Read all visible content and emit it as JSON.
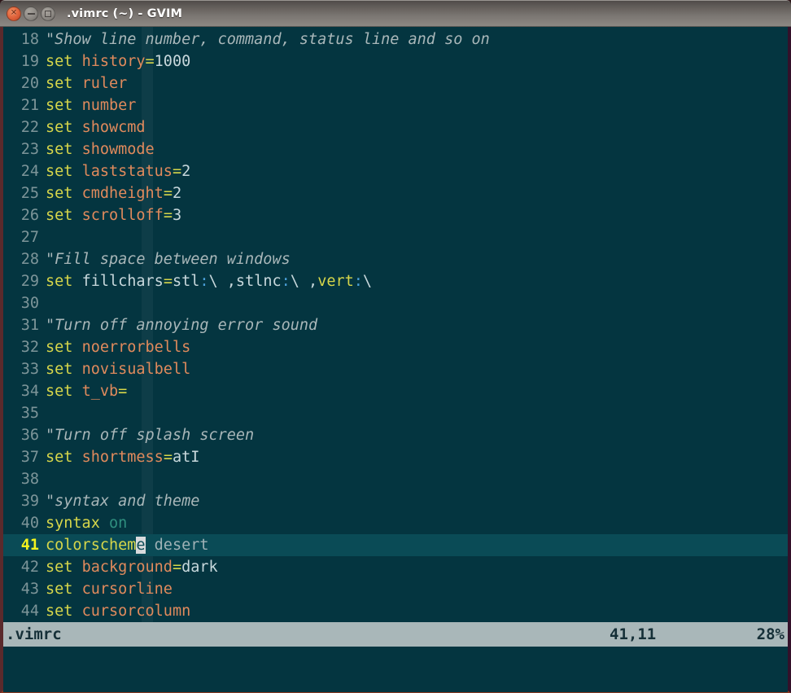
{
  "window": {
    "title": ".vimrc (~) - GVIM",
    "buttons": [
      {
        "name": "close",
        "glyph": "✕"
      },
      {
        "name": "minimize",
        "glyph": "–"
      },
      {
        "name": "maximize",
        "glyph": "□"
      }
    ]
  },
  "editor": {
    "first_visible_line": 18,
    "cursor_line": 41,
    "cursor_col": 11,
    "lines": [
      {
        "num": "18",
        "tokens": [
          {
            "t": "\"Show line number, command, status line and so on",
            "c": "cm"
          }
        ]
      },
      {
        "num": "19",
        "tokens": [
          {
            "t": "set",
            "c": "kw"
          },
          {
            "t": " ",
            "c": "pln"
          },
          {
            "t": "history",
            "c": "opt"
          },
          {
            "t": "=",
            "c": "eq"
          },
          {
            "t": "1000",
            "c": "num"
          }
        ]
      },
      {
        "num": "20",
        "tokens": [
          {
            "t": "set",
            "c": "kw"
          },
          {
            "t": " ",
            "c": "pln"
          },
          {
            "t": "ruler",
            "c": "opt"
          }
        ]
      },
      {
        "num": "21",
        "tokens": [
          {
            "t": "set",
            "c": "kw"
          },
          {
            "t": " ",
            "c": "pln"
          },
          {
            "t": "number",
            "c": "opt"
          }
        ]
      },
      {
        "num": "22",
        "tokens": [
          {
            "t": "set",
            "c": "kw"
          },
          {
            "t": " ",
            "c": "pln"
          },
          {
            "t": "showcmd",
            "c": "opt"
          }
        ]
      },
      {
        "num": "23",
        "tokens": [
          {
            "t": "set",
            "c": "kw"
          },
          {
            "t": " ",
            "c": "pln"
          },
          {
            "t": "showmode",
            "c": "opt"
          }
        ]
      },
      {
        "num": "24",
        "tokens": [
          {
            "t": "set",
            "c": "kw"
          },
          {
            "t": " ",
            "c": "pln"
          },
          {
            "t": "laststatus",
            "c": "opt"
          },
          {
            "t": "=",
            "c": "eq"
          },
          {
            "t": "2",
            "c": "num"
          }
        ]
      },
      {
        "num": "25",
        "tokens": [
          {
            "t": "set",
            "c": "kw"
          },
          {
            "t": " ",
            "c": "pln"
          },
          {
            "t": "cmdheight",
            "c": "opt"
          },
          {
            "t": "=",
            "c": "eq"
          },
          {
            "t": "2",
            "c": "num"
          }
        ]
      },
      {
        "num": "26",
        "tokens": [
          {
            "t": "set",
            "c": "kw"
          },
          {
            "t": " ",
            "c": "pln"
          },
          {
            "t": "scrolloff",
            "c": "opt"
          },
          {
            "t": "=",
            "c": "eq"
          },
          {
            "t": "3",
            "c": "num"
          }
        ]
      },
      {
        "num": "27",
        "tokens": []
      },
      {
        "num": "28",
        "tokens": [
          {
            "t": "\"Fill space between windows",
            "c": "cm"
          }
        ]
      },
      {
        "num": "29",
        "tokens": [
          {
            "t": "set",
            "c": "kw"
          },
          {
            "t": " ",
            "c": "pln"
          },
          {
            "t": "fillchars",
            "c": "pln"
          },
          {
            "t": "=",
            "c": "eq"
          },
          {
            "t": "stl",
            "c": "pln"
          },
          {
            "t": ":",
            "c": "col"
          },
          {
            "t": "\\ ,stlnc",
            "c": "pln"
          },
          {
            "t": ":",
            "c": "col"
          },
          {
            "t": "\\ ,",
            "c": "pln"
          },
          {
            "t": "vert",
            "c": "kw"
          },
          {
            "t": ":",
            "c": "col"
          },
          {
            "t": "\\",
            "c": "pln"
          }
        ]
      },
      {
        "num": "30",
        "tokens": []
      },
      {
        "num": "31",
        "tokens": [
          {
            "t": "\"Turn off annoying error sound",
            "c": "cm"
          }
        ]
      },
      {
        "num": "32",
        "tokens": [
          {
            "t": "set",
            "c": "kw"
          },
          {
            "t": " ",
            "c": "pln"
          },
          {
            "t": "noerrorbells",
            "c": "opt"
          }
        ]
      },
      {
        "num": "33",
        "tokens": [
          {
            "t": "set",
            "c": "kw"
          },
          {
            "t": " ",
            "c": "pln"
          },
          {
            "t": "novisualbell",
            "c": "opt"
          }
        ]
      },
      {
        "num": "34",
        "tokens": [
          {
            "t": "set",
            "c": "kw"
          },
          {
            "t": " ",
            "c": "pln"
          },
          {
            "t": "t_vb",
            "c": "opt"
          },
          {
            "t": "=",
            "c": "eq"
          }
        ]
      },
      {
        "num": "35",
        "tokens": []
      },
      {
        "num": "36",
        "tokens": [
          {
            "t": "\"Turn off splash screen",
            "c": "cm"
          }
        ]
      },
      {
        "num": "37",
        "tokens": [
          {
            "t": "set",
            "c": "kw"
          },
          {
            "t": " ",
            "c": "pln"
          },
          {
            "t": "shortmess",
            "c": "opt"
          },
          {
            "t": "=",
            "c": "eq"
          },
          {
            "t": "atI",
            "c": "num"
          }
        ]
      },
      {
        "num": "38",
        "tokens": []
      },
      {
        "num": "39",
        "tokens": [
          {
            "t": "\"syntax and theme",
            "c": "cm"
          }
        ]
      },
      {
        "num": "40",
        "tokens": [
          {
            "t": "syntax",
            "c": "kw"
          },
          {
            "t": " ",
            "c": "pln"
          },
          {
            "t": "on",
            "c": "on"
          }
        ]
      },
      {
        "num": "41",
        "cursorline": true,
        "tokens": [
          {
            "t": "colorschem",
            "c": "schm"
          },
          {
            "t": "e",
            "c": "schm",
            "cursor": true
          },
          {
            "t": " ",
            "c": "pln"
          },
          {
            "t": "desert",
            "c": "dsrt"
          }
        ]
      },
      {
        "num": "42",
        "tokens": [
          {
            "t": "set",
            "c": "kw"
          },
          {
            "t": " ",
            "c": "pln"
          },
          {
            "t": "background",
            "c": "opt"
          },
          {
            "t": "=",
            "c": "eq"
          },
          {
            "t": "dark",
            "c": "num"
          }
        ]
      },
      {
        "num": "43",
        "tokens": [
          {
            "t": "set",
            "c": "kw"
          },
          {
            "t": " ",
            "c": "pln"
          },
          {
            "t": "cursorline",
            "c": "opt"
          }
        ]
      },
      {
        "num": "44",
        "tokens": [
          {
            "t": "set",
            "c": "kw"
          },
          {
            "t": " ",
            "c": "pln"
          },
          {
            "t": "cursorcolumn",
            "c": "opt"
          }
        ]
      }
    ]
  },
  "statusline": {
    "filename": ".vimrc",
    "ruler": "41,11",
    "percent": "28%"
  },
  "cmdline": {
    "text": ""
  },
  "colors": {
    "editor_bg": "#043540",
    "cursorline_bg": "#0a4b56",
    "statusline_bg": "#a9b7b9",
    "statusline_fg": "#163038",
    "linenumber_fg": "#7d9599",
    "comment": "#a9b7b9",
    "keyword": "#d6d64a",
    "option": "#e08a5c",
    "value": "#c8d8dc",
    "cursor": "#d8dadc"
  }
}
